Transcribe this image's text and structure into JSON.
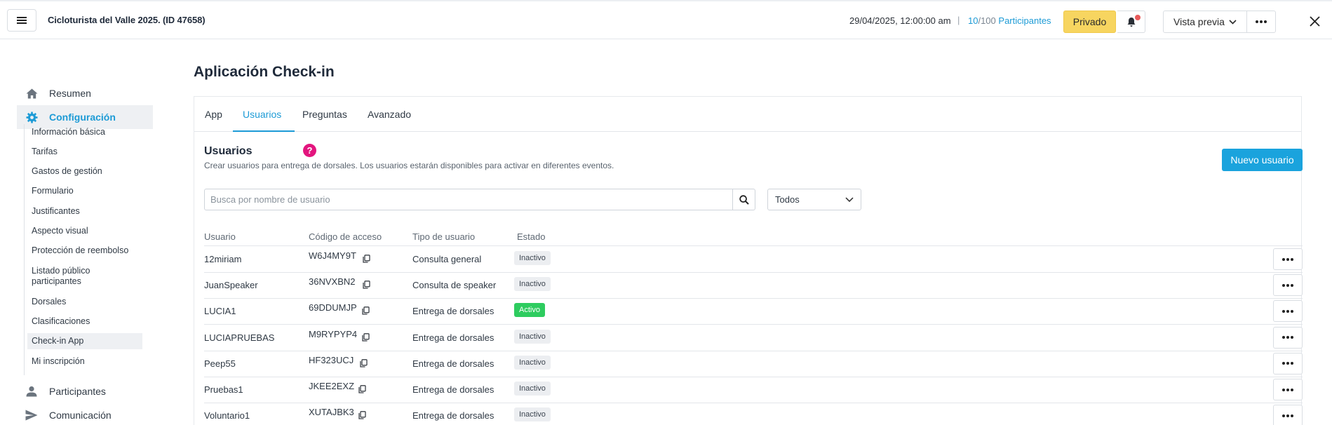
{
  "topbar": {
    "event_title": "Cicloturista del Valle 2025. (ID 47658)",
    "event_date": "29/04/2025, 12:00:00 am",
    "separator": "|",
    "participants_current": "10",
    "participants_total": "/100",
    "participants_label": " Participantes",
    "private_label": "Privado",
    "preview_label": "Vista previa",
    "icons": [
      "menu-icon",
      "bell-icon",
      "chevron-down-icon",
      "more-icon",
      "close-icon"
    ]
  },
  "sidebar": {
    "main_items": [
      {
        "label": "Resumen",
        "icon": "home-icon"
      },
      {
        "label": "Configuración",
        "icon": "gear-icon"
      },
      {
        "label": "Participantes",
        "icon": "person-icon"
      },
      {
        "label": "Comunicación",
        "icon": "send-icon"
      }
    ],
    "sub_items": [
      "Información básica",
      "Tarifas",
      "Gastos de gestión",
      "Formulario",
      "Justificantes",
      "Aspecto visual",
      "Protección de reembolso",
      "Listado público participantes",
      "Dorsales",
      "Clasificaciones",
      "Check-in App",
      "Mi inscripción"
    ]
  },
  "main": {
    "page_title": "Aplicación Check-in",
    "tabs": [
      "App",
      "Usuarios",
      "Preguntas",
      "Avanzado"
    ],
    "section_title": "Usuarios",
    "help_glyph": "?",
    "section_description": "Crear usuarios para entrega de dorsales. Los usuarios estarán disponibles para activar en diferentes eventos.",
    "new_user_label": "Nuevo usuario",
    "search_placeholder": "Busca por nombre de usuario",
    "filter_value": "Todos",
    "table": {
      "headers": [
        "Usuario",
        "Código de acceso",
        "Tipo de usuario",
        "Estado"
      ],
      "rows": [
        {
          "user": "12miriam",
          "code": "W6J4MY9T",
          "type": "Consulta general",
          "status": "Inactivo"
        },
        {
          "user": "JuanSpeaker",
          "code": "36NVXBN2",
          "type": "Consulta de speaker",
          "status": "Inactivo"
        },
        {
          "user": "LUCIA1",
          "code": "69DDUMJP",
          "type": "Entrega de dorsales",
          "status": "Activo"
        },
        {
          "user": "LUCIAPRUEBAS",
          "code": "M9RYPYP4",
          "type": "Entrega de dorsales",
          "status": "Inactivo"
        },
        {
          "user": "Peep55",
          "code": "HF323UCJ",
          "type": "Entrega de dorsales",
          "status": "Inactivo"
        },
        {
          "user": "Pruebas1",
          "code": "JKEE2EXZ",
          "type": "Entrega de dorsales",
          "status": "Inactivo"
        },
        {
          "user": "Voluntario1",
          "code": "XUTAJBK3",
          "type": "Entrega de dorsales",
          "status": "Inactivo"
        }
      ]
    }
  },
  "colors": {
    "accent": "#1d9bd6",
    "private_yellow": "#f7d560",
    "help_pink": "#e3157e",
    "active_green": "#2ecc5f",
    "notification_red": "#e85a5a"
  }
}
